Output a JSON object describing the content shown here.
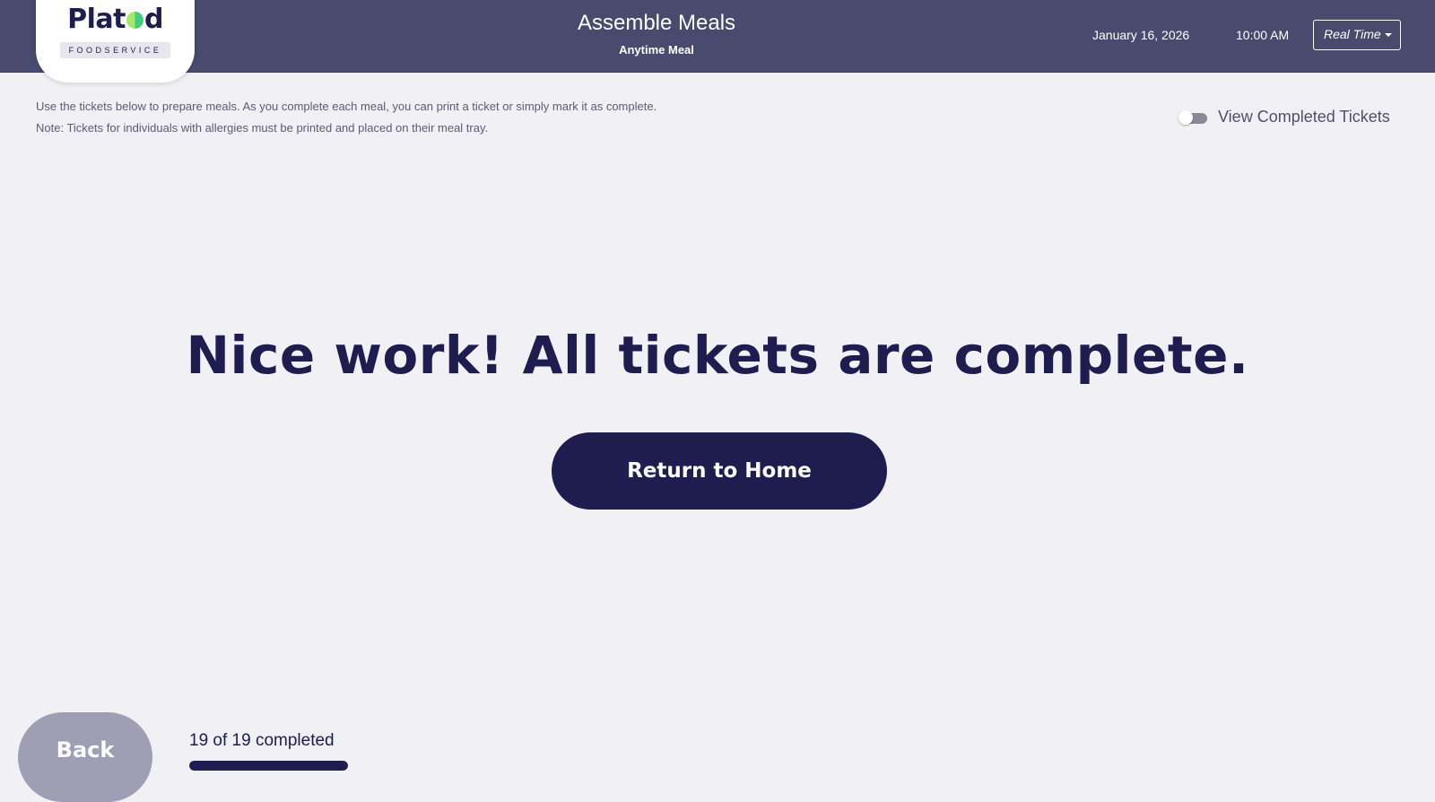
{
  "brand": {
    "name_part1": "Plat",
    "name_part2": "d",
    "tagline": "FOODSERVICE"
  },
  "header": {
    "title": "Assemble Meals",
    "subtitle": "Anytime Meal",
    "date": "January 16, 2026",
    "time": "10:00 AM",
    "mode_select": {
      "selected": "Real Time"
    }
  },
  "instructions": "Use the tickets below to prepare meals. As you complete each meal, you can print a ticket or simply mark it as complete. Note: Tickets for individuals with allergies must be printed and placed on their meal tray.",
  "completed_toggle": {
    "label": "View Completed Tickets",
    "on": false
  },
  "main": {
    "headline": "Nice work! All tickets are complete.",
    "return_button": "Return to Home"
  },
  "footer": {
    "back_button": "Back",
    "progress_text": "19 of 19 completed",
    "completed": 19,
    "total": 19
  },
  "colors": {
    "header_bg": "#484a6e",
    "primary_navy": "#1f1d4f",
    "page_bg": "#f1f0f5",
    "back_button": "#a09eb5",
    "logo_green": "#3ecf7b"
  },
  "icons": {
    "dropdown": "caret-down-icon",
    "logo_mark": "plate-dot-icon"
  }
}
